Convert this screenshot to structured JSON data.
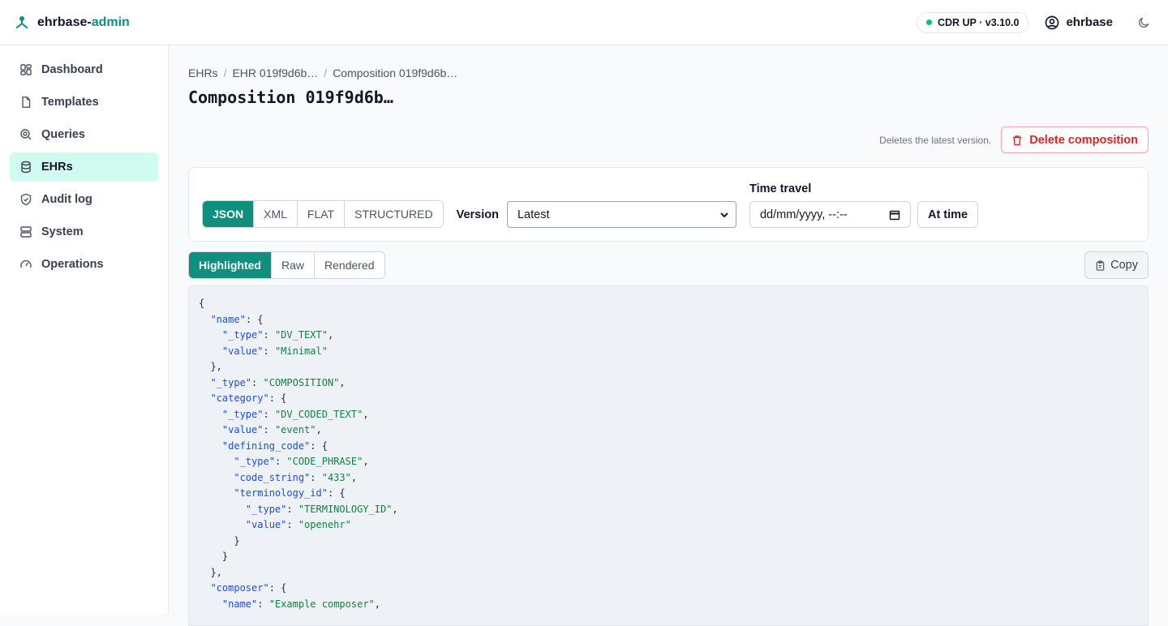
{
  "header": {
    "brand_prefix": "ehrbase-",
    "brand_accent": "admin",
    "status": "CDR UP · v3.10.0",
    "user": "ehrbase"
  },
  "sidebar": {
    "items": [
      {
        "label": "Dashboard",
        "icon": "dashboard-icon",
        "active": false
      },
      {
        "label": "Templates",
        "icon": "file-icon",
        "active": false
      },
      {
        "label": "Queries",
        "icon": "search-icon",
        "active": false
      },
      {
        "label": "EHRs",
        "icon": "database-icon",
        "active": true
      },
      {
        "label": "Audit log",
        "icon": "shield-icon",
        "active": false
      },
      {
        "label": "System",
        "icon": "server-icon",
        "active": false
      },
      {
        "label": "Operations",
        "icon": "gauge-icon",
        "active": false
      }
    ]
  },
  "breadcrumb": [
    "EHRs",
    "EHR 019f9d6b…",
    "Composition 019f9d6b…"
  ],
  "page": {
    "title": "Composition 019f9d6b…",
    "delete_hint": "Deletes the latest version.",
    "delete_label": "Delete composition"
  },
  "controls": {
    "formats": [
      "JSON",
      "XML",
      "FLAT",
      "STRUCTURED"
    ],
    "active_format": "JSON",
    "version_label": "Version",
    "version_value": "Latest",
    "time_travel_label": "Time travel",
    "date_placeholder": "dd/mm/yyyy, --:--",
    "at_time_label": "At time"
  },
  "view": {
    "modes": [
      "Highlighted",
      "Raw",
      "Rendered"
    ],
    "active_mode": "Highlighted",
    "copy_label": "Copy"
  },
  "code_lines": [
    [
      [
        "p",
        "{"
      ]
    ],
    [
      [
        "p",
        "  "
      ],
      [
        "k",
        "\"name\""
      ],
      [
        "p",
        ": {"
      ]
    ],
    [
      [
        "p",
        "    "
      ],
      [
        "k",
        "\"_type\""
      ],
      [
        "p",
        ": "
      ],
      [
        "s",
        "\"DV_TEXT\""
      ],
      [
        "p",
        ","
      ]
    ],
    [
      [
        "p",
        "    "
      ],
      [
        "k",
        "\"value\""
      ],
      [
        "p",
        ": "
      ],
      [
        "s",
        "\"Minimal\""
      ]
    ],
    [
      [
        "p",
        "  },"
      ]
    ],
    [
      [
        "p",
        "  "
      ],
      [
        "k",
        "\"_type\""
      ],
      [
        "p",
        ": "
      ],
      [
        "s",
        "\"COMPOSITION\""
      ],
      [
        "p",
        ","
      ]
    ],
    [
      [
        "p",
        "  "
      ],
      [
        "k",
        "\"category\""
      ],
      [
        "p",
        ": {"
      ]
    ],
    [
      [
        "p",
        "    "
      ],
      [
        "k",
        "\"_type\""
      ],
      [
        "p",
        ": "
      ],
      [
        "s",
        "\"DV_CODED_TEXT\""
      ],
      [
        "p",
        ","
      ]
    ],
    [
      [
        "p",
        "    "
      ],
      [
        "k",
        "\"value\""
      ],
      [
        "p",
        ": "
      ],
      [
        "s",
        "\"event\""
      ],
      [
        "p",
        ","
      ]
    ],
    [
      [
        "p",
        "    "
      ],
      [
        "k",
        "\"defining_code\""
      ],
      [
        "p",
        ": {"
      ]
    ],
    [
      [
        "p",
        "      "
      ],
      [
        "k",
        "\"_type\""
      ],
      [
        "p",
        ": "
      ],
      [
        "s",
        "\"CODE_PHRASE\""
      ],
      [
        "p",
        ","
      ]
    ],
    [
      [
        "p",
        "      "
      ],
      [
        "k",
        "\"code_string\""
      ],
      [
        "p",
        ": "
      ],
      [
        "s",
        "\"433\""
      ],
      [
        "p",
        ","
      ]
    ],
    [
      [
        "p",
        "      "
      ],
      [
        "k",
        "\"terminology_id\""
      ],
      [
        "p",
        ": {"
      ]
    ],
    [
      [
        "p",
        "        "
      ],
      [
        "k",
        "\"_type\""
      ],
      [
        "p",
        ": "
      ],
      [
        "s",
        "\"TERMINOLOGY_ID\""
      ],
      [
        "p",
        ","
      ]
    ],
    [
      [
        "p",
        "        "
      ],
      [
        "k",
        "\"value\""
      ],
      [
        "p",
        ": "
      ],
      [
        "s",
        "\"openehr\""
      ]
    ],
    [
      [
        "p",
        "      }"
      ]
    ],
    [
      [
        "p",
        "    }"
      ]
    ],
    [
      [
        "p",
        "  },"
      ]
    ],
    [
      [
        "p",
        "  "
      ],
      [
        "k",
        "\"composer\""
      ],
      [
        "p",
        ": {"
      ]
    ],
    [
      [
        "p",
        "    "
      ],
      [
        "k",
        "\"name\""
      ],
      [
        "p",
        ": "
      ],
      [
        "s",
        "\"Example composer\""
      ],
      [
        "p",
        ","
      ]
    ]
  ],
  "colors": {
    "accent": "#0f8f7e",
    "active_nav_bg": "#d1faf0",
    "danger": "#dc2626",
    "json_key": "#1d4ed8",
    "json_string": "#15803d",
    "status_dot": "#10b981"
  }
}
